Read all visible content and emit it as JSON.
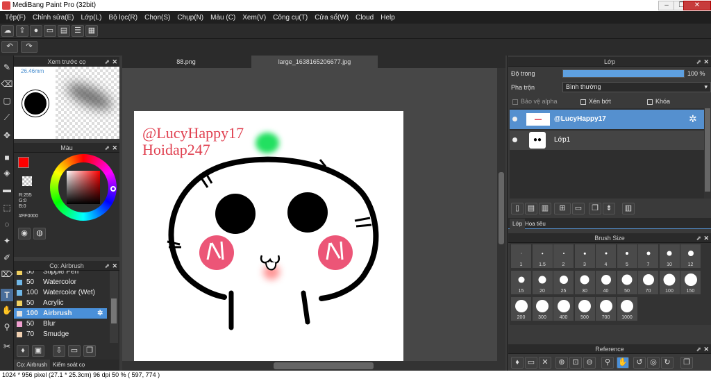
{
  "window": {
    "title": "MediBang Paint Pro (32bit)"
  },
  "menu": [
    "Tệp(F)",
    "Chỉnh sửa(E)",
    "Lớp(L)",
    "Bộ lọc(R)",
    "Chọn(S)",
    "Chụp(N)",
    "Màu (C)",
    "Xem(V)",
    "Công cụ(T)",
    "Cửa sổ(W)",
    "Cloud",
    "Help"
  ],
  "brush_preview": {
    "title": "Xem trước cọ",
    "size": "26.46mm"
  },
  "color_panel": {
    "title": "Màu",
    "r": "R:255",
    "g": "G:0",
    "b": "B:0",
    "hex": "#FF0000"
  },
  "brush_panel": {
    "title": "Cọ: Airbrush",
    "items": [
      {
        "size": "50",
        "name": "Stipple Pen",
        "color": "#f0d060"
      },
      {
        "size": "50",
        "name": "Watercolor",
        "color": "#70b8e8"
      },
      {
        "size": "100",
        "name": "Watercolor (Wet)",
        "color": "#70b8e8"
      },
      {
        "size": "50",
        "name": "Acrylic",
        "color": "#f0d060"
      },
      {
        "size": "100",
        "name": "Airbrush",
        "color": "#e0e0e0"
      },
      {
        "size": "50",
        "name": "Blur",
        "color": "#f0a0d0"
      },
      {
        "size": "70",
        "name": "Smudge",
        "color": "#f0d0b0"
      }
    ],
    "bottom_tabs": [
      "Cọ: Airbrush",
      "Kiểm soát cọ"
    ]
  },
  "tabs": [
    "88.png",
    "large_1638165206677.jpg"
  ],
  "canvas": {
    "text1": "@LucyHappy17",
    "text2": "Hoidap247"
  },
  "layer_panel": {
    "title": "Lớp",
    "opacity_label": "Độ trong",
    "opacity_value": "100 %",
    "opacity": 1.0,
    "blend_label": "Pha trộn",
    "blend_value": "Bình thường",
    "protect_alpha": "Bảo vệ alpha",
    "clipping": "Xén bớt",
    "lock": "Khóa",
    "layers": [
      {
        "name": "@LucyHappy17",
        "selected": true
      },
      {
        "name": "Lớp1",
        "selected": false
      }
    ],
    "bottom_tabs": [
      "Lớp",
      "Hoa tiêu"
    ]
  },
  "brush_size": {
    "title": "Brush Size",
    "sizes": [
      "1",
      "1.5",
      "2",
      "3",
      "4",
      "5",
      "7",
      "10",
      "12",
      "15",
      "20",
      "25",
      "30",
      "40",
      "50",
      "70",
      "100",
      "150",
      "200",
      "300",
      "400",
      "500",
      "700",
      "1000"
    ]
  },
  "reference": {
    "title": "Reference"
  },
  "status": "1024 * 956 pixel  (27.1 * 25.3cm)  96 dpi  50 %  ( 597, 774 )"
}
